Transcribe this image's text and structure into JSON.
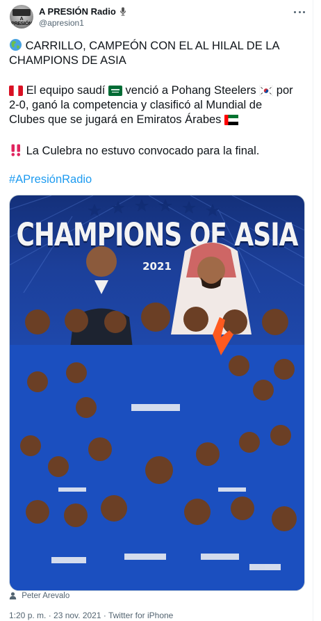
{
  "tweet": {
    "display_name": "A PRESIÓN Radio",
    "handle": "@apresion1",
    "avatar": {
      "logo_word": "A PRESIÓN",
      "logo_sub": "RADIO"
    },
    "line1": "CARRILLO, CAMPEÓN CON EL AL HILAL DE LA CHAMPIONS DE ASIA",
    "line2_a": "El equipo saudí",
    "line2_b": "venció a Pohang Steelers",
    "line2_c": "por 2-0, ganó la competencia y clasificó al Mundial de Clubes que se jugará en Emiratos Árabes",
    "line3": "La Culebra no estuvo convocado para la final.",
    "hashtag": "#APresiónRadio",
    "photo_credit": "Peter Arevalo",
    "meta": "1:20 p. m. · 23 nov. 2021 · Twitter for iPhone"
  },
  "image": {
    "title": "CHAMPIONS OF ASIA",
    "year": "2021"
  },
  "icons": [
    "globe-icon",
    "peru-flag-icon",
    "saudi-flag-icon",
    "korea-flag-icon",
    "uae-flag-icon",
    "double-exclamation-icon",
    "microphone-icon",
    "more-options-icon",
    "person-icon"
  ],
  "colors": {
    "link": "#1d9bf0",
    "secondary_text": "#536471",
    "kit_blue": "#1b4fbf"
  }
}
